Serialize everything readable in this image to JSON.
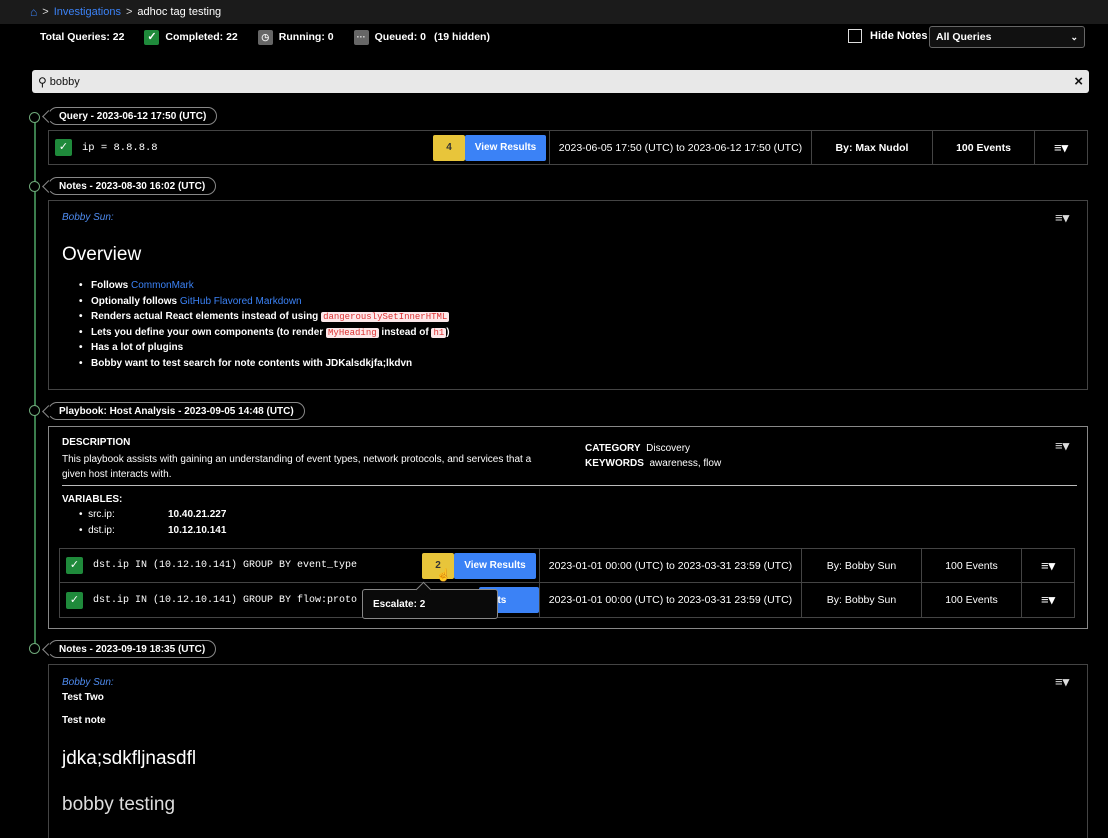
{
  "breadcrumb": {
    "home_icon": "home-icon",
    "items": [
      "Investigations",
      "adhoc tag testing"
    ]
  },
  "stats": {
    "total_queries": "Total Queries: 22",
    "completed": "Completed: 22",
    "running": "Running: 0",
    "queued": "Queued: 0",
    "hidden": "(19 hidden)"
  },
  "hide_notes_label": "Hide Notes",
  "query_filter": {
    "selected": "All Queries"
  },
  "search": {
    "value": "bobby"
  },
  "timeline": [
    {
      "type": "query",
      "label": "Query - 2023-06-12 17:50 (UTC)",
      "query": "ip = 8.8.8.8",
      "badge": "4",
      "view_label": "View Results",
      "range": "2023-06-05 17:50 (UTC) to 2023-06-12 17:50 (UTC)",
      "by": "By: Max Nudol",
      "events": "100 Events"
    },
    {
      "type": "note",
      "label": "Notes - 2023-08-30 16:02 (UTC)",
      "author": "Bobby Sun:",
      "heading": "Overview",
      "items": [
        {
          "pre": "Follows ",
          "link": "CommonMark"
        },
        {
          "pre": "Optionally follows ",
          "link": "GitHub Flavored Markdown"
        },
        {
          "pre": "Renders actual React elements instead of using ",
          "code": "dangerouslySetInnerHTML"
        },
        {
          "pre": "Lets you define your own components (to render ",
          "code": "MyHeading",
          "mid": " instead of ",
          "code2": "h1",
          "post": ")"
        },
        {
          "pre": "Has a lot of plugins"
        },
        {
          "pre": "Bobby want to test search for note contents with JDKalsdkjfa;lkdvn"
        }
      ]
    },
    {
      "type": "playbook",
      "label": "Playbook: Host Analysis - 2023-09-05 14:48 (UTC)",
      "description_label": "DESCRIPTION",
      "description": "This playbook assists with gaining an understanding of event types, network protocols, and services that a given host interacts with.",
      "category_label": "CATEGORY",
      "category": "Discovery",
      "keywords_label": "KEYWORDS",
      "keywords": "awareness, flow",
      "variables_label": "VARIABLES:",
      "variables": [
        {
          "name": "src.ip:",
          "value": "10.40.21.227"
        },
        {
          "name": "dst.ip:",
          "value": "10.12.10.141"
        }
      ],
      "queries": [
        {
          "query": "dst.ip IN (10.12.10.141) GROUP BY event_type",
          "badge": "2",
          "view_label": "View Results",
          "range": "2023-01-01 00:00 (UTC) to 2023-03-31 23:59 (UTC)",
          "by": "By: Bobby Sun",
          "events": "100 Events"
        },
        {
          "query": "dst.ip IN (10.12.10.141) GROUP BY flow:proto",
          "badge": "",
          "view_label": "sults",
          "range": "2023-01-01 00:00 (UTC) to 2023-03-31 23:59 (UTC)",
          "by": "By: Bobby Sun",
          "events": "100 Events"
        }
      ],
      "tooltip": "Escalate: 2"
    },
    {
      "type": "note",
      "label": "Notes - 2023-09-19 18:35 (UTC)",
      "author": "Bobby Sun:",
      "line1": "Test Two",
      "line2": "Test note",
      "heading1": "jdka;sdkfljnasdfl",
      "heading2": "bobby testing"
    }
  ],
  "colors": {
    "accent": "#3b82f6",
    "success": "#1f8a3b",
    "badge": "#e8c53a",
    "timeline": "#3b7d4d"
  }
}
